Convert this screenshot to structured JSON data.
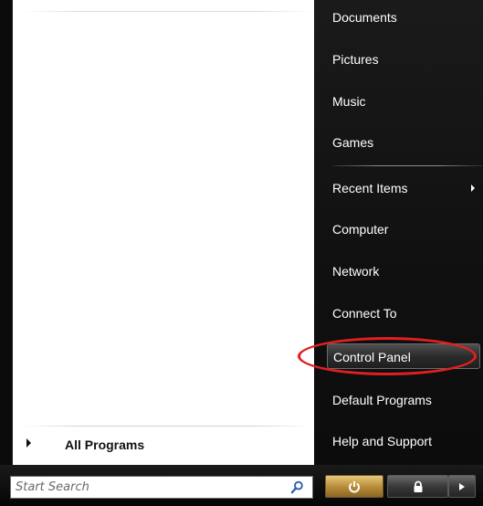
{
  "left_pane": {
    "all_programs_label": "All Programs"
  },
  "search": {
    "placeholder": "Start Search",
    "icon": "search-icon"
  },
  "right_pane": {
    "items": [
      {
        "label": "Documents"
      },
      {
        "label": "Pictures"
      },
      {
        "label": "Music"
      },
      {
        "label": "Games"
      },
      {
        "label": "Recent Items",
        "submenu": true
      },
      {
        "label": "Computer"
      },
      {
        "label": "Network"
      },
      {
        "label": "Connect To"
      },
      {
        "label": "Control Panel",
        "highlighted": true,
        "annotated": "red-ellipse"
      },
      {
        "label": "Default Programs"
      },
      {
        "label": "Help and Support"
      }
    ]
  },
  "power_buttons": {
    "power_icon": "power-icon",
    "lock_icon": "lock-icon",
    "options_icon": "arrow-right-icon"
  },
  "colors": {
    "annotation": "#e02020",
    "power_button": "#c49a45",
    "right_pane_bg": "#141414"
  }
}
